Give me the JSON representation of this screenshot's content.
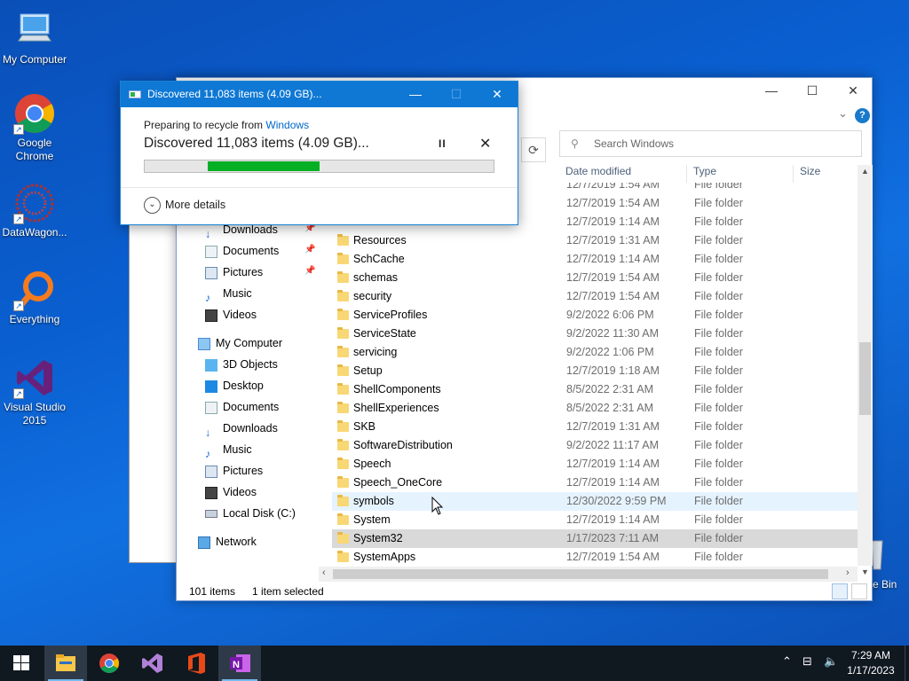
{
  "desktop": {
    "icons": [
      {
        "label": "My Computer",
        "icon": "computer-icon"
      },
      {
        "label": "Google Chrome",
        "icon": "chrome-icon"
      },
      {
        "label": "DataWagon...",
        "icon": "datawagon-icon"
      },
      {
        "label": "Everything",
        "icon": "everything-search-icon"
      },
      {
        "label": "Visual Studio 2015",
        "icon": "visual-studio-icon"
      }
    ],
    "recycle_bin_label": "e Bin"
  },
  "progress_dialog": {
    "title": "Discovered 11,083 items (4.09 GB)...",
    "sub_prefix": "Preparing to recycle from ",
    "sub_link": "Windows",
    "main_text": "Discovered 11,083 items (4.09 GB)...",
    "pause_label": "II",
    "cancel_label": "✕",
    "progress_start": 0.18,
    "progress_end": 0.5,
    "progress_color": "#06b025",
    "more_details": "More details"
  },
  "explorer": {
    "search_placeholder": "Search Windows",
    "columns": {
      "date": "Date modified",
      "type": "Type",
      "size": "Size"
    },
    "nav": {
      "quick": [
        {
          "label": "Downloads",
          "icon": "download-arrow-icon",
          "pinned": true
        },
        {
          "label": "Documents",
          "icon": "documents-icon",
          "pinned": true
        },
        {
          "label": "Pictures",
          "icon": "pictures-icon",
          "pinned": true
        },
        {
          "label": "Music",
          "icon": "music-icon",
          "pinned": false
        },
        {
          "label": "Videos",
          "icon": "videos-icon",
          "pinned": false
        }
      ],
      "this_pc": "My Computer",
      "pc_items": [
        {
          "label": "3D Objects",
          "icon": "3d-objects-icon"
        },
        {
          "label": "Desktop",
          "icon": "desktop-icon"
        },
        {
          "label": "Documents",
          "icon": "documents-icon"
        },
        {
          "label": "Downloads",
          "icon": "download-arrow-icon"
        },
        {
          "label": "Music",
          "icon": "music-icon"
        },
        {
          "label": "Pictures",
          "icon": "pictures-icon"
        },
        {
          "label": "Videos",
          "icon": "videos-icon"
        },
        {
          "label": "Local Disk (C:)",
          "icon": "drive-icon"
        }
      ],
      "network": "Network"
    },
    "partial_top_row": {
      "date": "12/7/2019 1:54 AM",
      "type": "File folder"
    },
    "rows": [
      {
        "name": "",
        "date": "12/7/2019 1:54 AM",
        "type": "File folder"
      },
      {
        "name": "",
        "date": "12/7/2019 1:14 AM",
        "type": "File folder"
      },
      {
        "name": "Resources",
        "date": "12/7/2019 1:31 AM",
        "type": "File folder"
      },
      {
        "name": "SchCache",
        "date": "12/7/2019 1:14 AM",
        "type": "File folder"
      },
      {
        "name": "schemas",
        "date": "12/7/2019 1:54 AM",
        "type": "File folder"
      },
      {
        "name": "security",
        "date": "12/7/2019 1:54 AM",
        "type": "File folder"
      },
      {
        "name": "ServiceProfiles",
        "date": "9/2/2022 6:06 PM",
        "type": "File folder"
      },
      {
        "name": "ServiceState",
        "date": "9/2/2022 11:30 AM",
        "type": "File folder"
      },
      {
        "name": "servicing",
        "date": "9/2/2022 1:06 PM",
        "type": "File folder"
      },
      {
        "name": "Setup",
        "date": "12/7/2019 1:18 AM",
        "type": "File folder"
      },
      {
        "name": "ShellComponents",
        "date": "8/5/2022 2:31 AM",
        "type": "File folder"
      },
      {
        "name": "ShellExperiences",
        "date": "8/5/2022 2:31 AM",
        "type": "File folder"
      },
      {
        "name": "SKB",
        "date": "12/7/2019 1:31 AM",
        "type": "File folder"
      },
      {
        "name": "SoftwareDistribution",
        "date": "9/2/2022 11:17 AM",
        "type": "File folder"
      },
      {
        "name": "Speech",
        "date": "12/7/2019 1:14 AM",
        "type": "File folder"
      },
      {
        "name": "Speech_OneCore",
        "date": "12/7/2019 1:14 AM",
        "type": "File folder"
      },
      {
        "name": "symbols",
        "date": "12/30/2022 9:59 PM",
        "type": "File folder",
        "state": "hover"
      },
      {
        "name": "System",
        "date": "12/7/2019 1:14 AM",
        "type": "File folder"
      },
      {
        "name": "System32",
        "date": "1/17/2023 7:11 AM",
        "type": "File folder",
        "state": "selected"
      },
      {
        "name": "SystemApps",
        "date": "12/7/2019 1:54 AM",
        "type": "File folder"
      }
    ],
    "status": {
      "items": "101 items",
      "selected": "1 item selected"
    }
  },
  "taskbar": {
    "apps": [
      "file-explorer-icon",
      "chrome-icon",
      "visual-studio-icon",
      "office-icon",
      "onenote-icon"
    ],
    "time": "7:29 AM",
    "date": "1/17/2023"
  }
}
